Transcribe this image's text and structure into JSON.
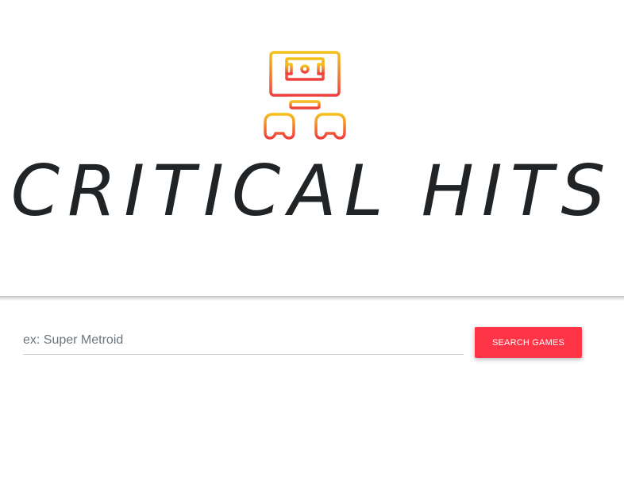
{
  "brand": {
    "title": "CRITICAL HITS",
    "logo_icon": "game-console-monitor-icon",
    "logo_gradient": [
      "#f5c21b",
      "#ef3e3e"
    ]
  },
  "search": {
    "placeholder": "ex: Super Metroid",
    "value": "",
    "button_label": "SEARCH GAMES",
    "button_color": "#ff3547"
  }
}
